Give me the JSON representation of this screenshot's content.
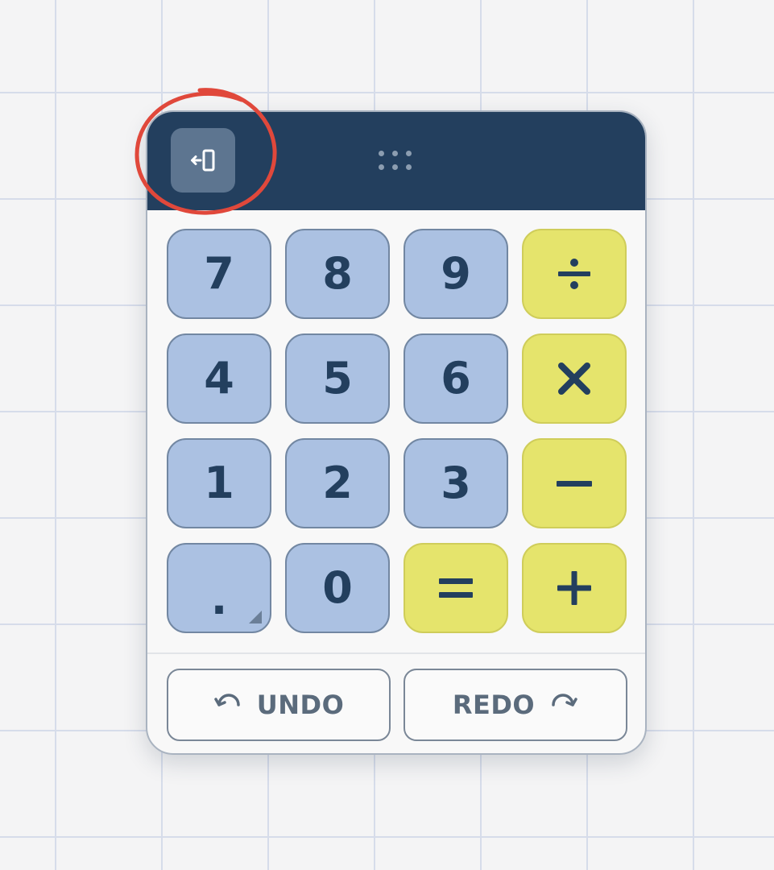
{
  "keypad": {
    "rows": [
      [
        {
          "label": "7",
          "kind": "num"
        },
        {
          "label": "8",
          "kind": "num"
        },
        {
          "label": "9",
          "kind": "num"
        },
        {
          "label": "÷",
          "kind": "op",
          "icon": "divide-icon"
        }
      ],
      [
        {
          "label": "4",
          "kind": "num"
        },
        {
          "label": "5",
          "kind": "num"
        },
        {
          "label": "6",
          "kind": "num"
        },
        {
          "label": "×",
          "kind": "op",
          "icon": "multiply-icon"
        }
      ],
      [
        {
          "label": "1",
          "kind": "num"
        },
        {
          "label": "2",
          "kind": "num"
        },
        {
          "label": "3",
          "kind": "num"
        },
        {
          "label": "−",
          "kind": "op",
          "icon": "minus-icon"
        }
      ],
      [
        {
          "label": ".",
          "kind": "num"
        },
        {
          "label": "0",
          "kind": "num"
        },
        {
          "label": "=",
          "kind": "op",
          "icon": "equals-icon"
        },
        {
          "label": "+",
          "kind": "op",
          "icon": "plus-icon"
        }
      ]
    ]
  },
  "history": {
    "undo_label": "UNDO",
    "redo_label": "REDO"
  },
  "header": {
    "exit_icon": "exit-panel-icon",
    "drag_icon": "drag-handle-icon"
  },
  "colors": {
    "header_bg": "#233f5e",
    "number_key": "#abc1e2",
    "operator_key": "#e5e46c",
    "key_text": "#233f5e",
    "annotation": "#e0483b"
  }
}
